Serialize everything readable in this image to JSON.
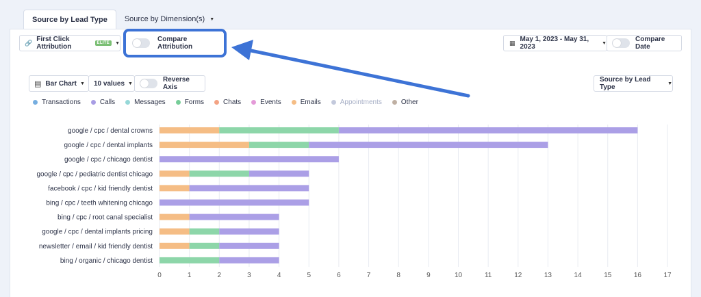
{
  "tabs": [
    {
      "label": "Source by Lead Type",
      "active": true
    },
    {
      "label": "Source by Dimension(s)",
      "active": false
    }
  ],
  "toolbar": {
    "attribution_model": "First Click Attribution",
    "attribution_badge": "ELITE",
    "compare_attribution_label": "Compare Attribution",
    "date_range": "May 1, 2023 - May 31, 2023",
    "compare_date_label": "Compare Date"
  },
  "chart_controls": {
    "chart_type": "Bar Chart",
    "values_count": "10 values",
    "reverse_axis_label": "Reverse Axis",
    "group_by": "Source by Lead Type"
  },
  "legend": [
    {
      "label": "Transactions",
      "color": "#76aee0"
    },
    {
      "label": "Calls",
      "color": "#a89de4"
    },
    {
      "label": "Messages",
      "color": "#96d8d8"
    },
    {
      "label": "Forms",
      "color": "#76cd98"
    },
    {
      "label": "Chats",
      "color": "#f3a384"
    },
    {
      "label": "Events",
      "color": "#e49ad8"
    },
    {
      "label": "Emails",
      "color": "#f5bd85"
    },
    {
      "label": "Appointments",
      "color": "#c3c9dc"
    },
    {
      "label": "Other",
      "color": "#bfb0a3"
    }
  ],
  "chart_data": {
    "type": "bar",
    "orientation": "horizontal",
    "stacked": true,
    "categories": [
      "google / cpc / dental crowns",
      "google / cpc / dental implants",
      "google / cpc / chicago dentist",
      "google / cpc / pediatric dentist chicago",
      "facebook / cpc / kid friendly dentist",
      "bing / cpc / teeth whitening chicago",
      "bing / cpc / root canal specialist",
      "google / cpc / dental implants pricing",
      "newsletter / email / kid friendly dentist",
      "bing / organic / chicago dentist"
    ],
    "series": [
      {
        "name": "Emails",
        "color": "#f5bd85",
        "values": [
          2,
          3,
          0,
          1,
          1,
          0,
          1,
          1,
          1,
          0
        ]
      },
      {
        "name": "Forms",
        "color": "#8dd6a9",
        "values": [
          4,
          2,
          0,
          2,
          0,
          0,
          0,
          1,
          1,
          2
        ]
      },
      {
        "name": "Calls",
        "color": "#ab9fe6",
        "values": [
          10,
          8,
          6,
          2,
          4,
          5,
          3,
          2,
          2,
          2
        ]
      }
    ],
    "xticks": [
      0,
      1,
      2,
      3,
      4,
      5,
      6,
      7,
      8,
      9,
      10,
      11,
      12,
      13,
      14,
      15,
      16,
      17
    ],
    "xlim": [
      0,
      17
    ],
    "grid": true
  }
}
